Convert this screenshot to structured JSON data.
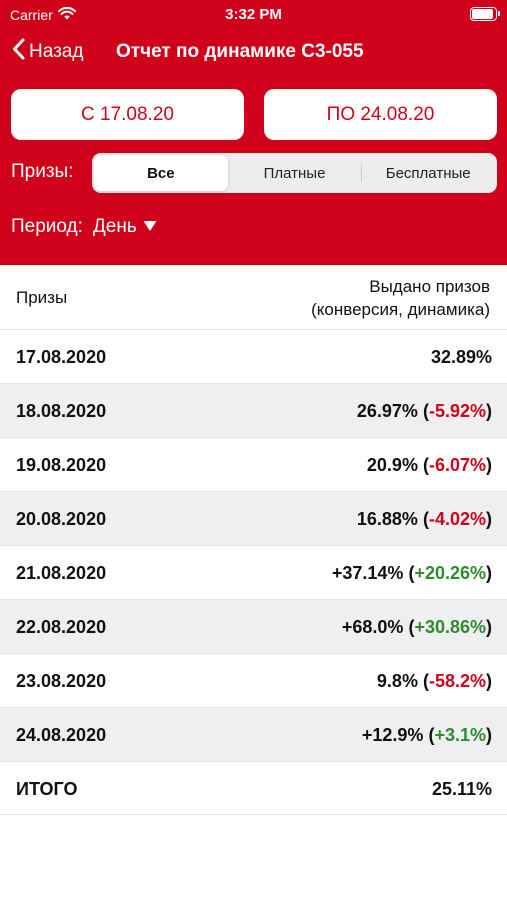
{
  "status_bar": {
    "carrier": "Carrier",
    "time": "3:32 PM"
  },
  "nav": {
    "back_label": "Назад",
    "title": "Отчет по динамике С3-055"
  },
  "filters": {
    "date_from": "С 17.08.20",
    "date_to": "ПО 24.08.20",
    "prizes_label": "Призы:",
    "segments": [
      "Все",
      "Платные",
      "Бесплатные"
    ],
    "selected_segment": "Все",
    "period_label": "Период:",
    "period_value": "День"
  },
  "table": {
    "header_left": "Призы",
    "header_right_line1": "Выдано призов",
    "header_right_line2": "(конверсия, динамика)",
    "rows": [
      {
        "date": "17.08.2020",
        "value": "32.89%",
        "change": "",
        "trend": ""
      },
      {
        "date": "18.08.2020",
        "value": "26.97%",
        "change": "-5.92%",
        "trend": "neg"
      },
      {
        "date": "19.08.2020",
        "value": "20.9%",
        "change": "-6.07%",
        "trend": "neg"
      },
      {
        "date": "20.08.2020",
        "value": "16.88%",
        "change": "-4.02%",
        "trend": "neg"
      },
      {
        "date": "21.08.2020",
        "value": "+37.14%",
        "change": "+20.26%",
        "trend": "pos"
      },
      {
        "date": "22.08.2020",
        "value": "+68.0%",
        "change": "+30.86%",
        "trend": "pos"
      },
      {
        "date": "23.08.2020",
        "value": "9.8%",
        "change": "-58.2%",
        "trend": "neg"
      },
      {
        "date": "24.08.2020",
        "value": "+12.9%",
        "change": "+3.1%",
        "trend": "pos"
      }
    ],
    "total_label": "ИТОГО",
    "total_value": "25.11%"
  },
  "colors": {
    "brand_red": "#d0021b",
    "positive": "#2e8b2e",
    "negative": "#d0021b"
  }
}
